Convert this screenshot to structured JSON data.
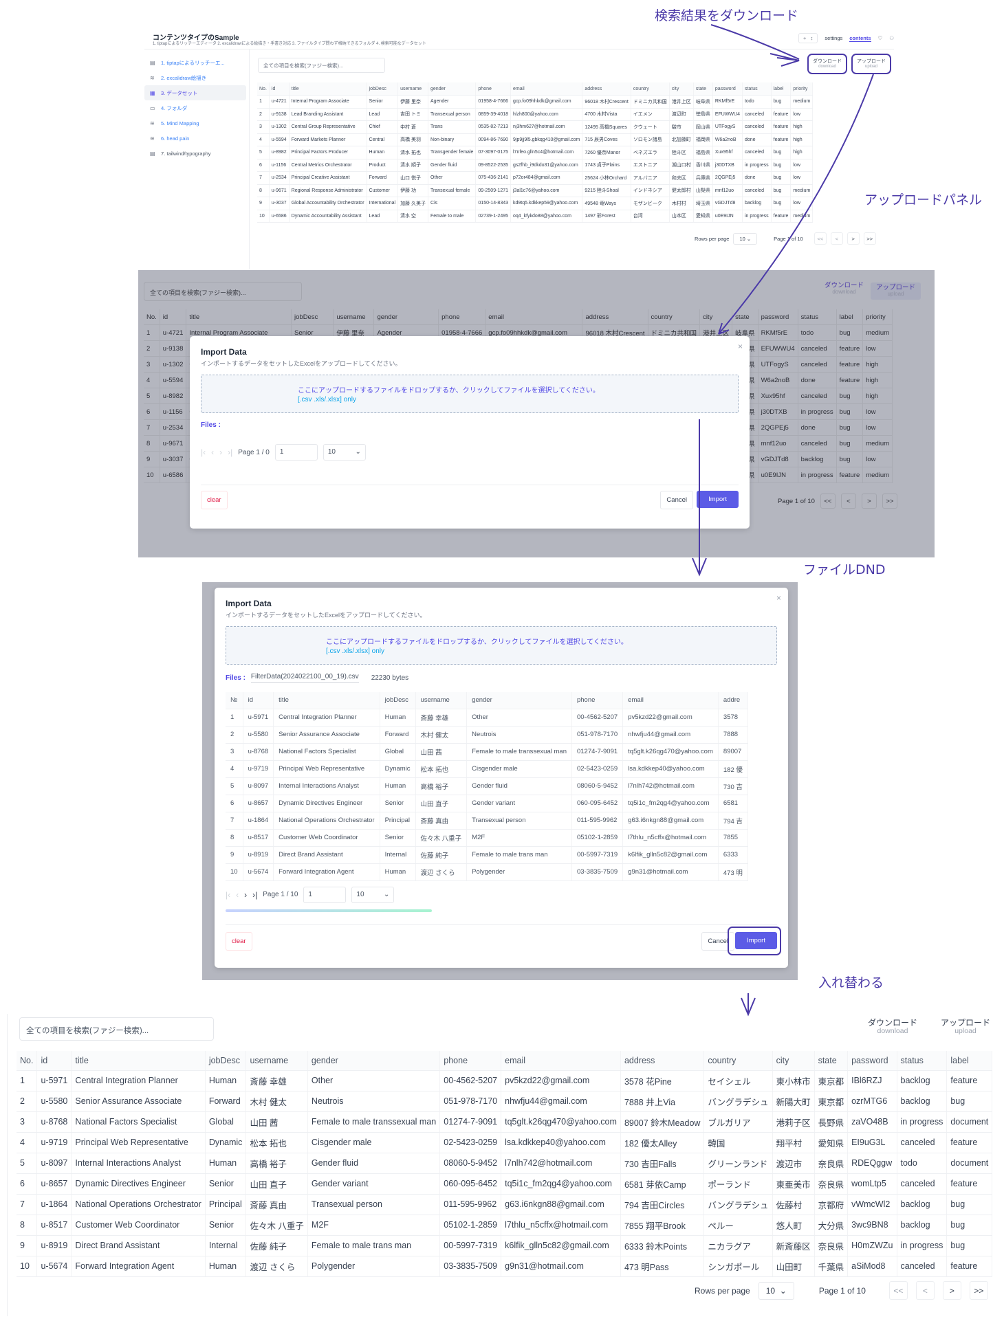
{
  "annotations": {
    "download_result": "検索結果をダウンロード",
    "upload_panel": "アップロードパネル",
    "file_dnd": "ファイルDND",
    "swap": "入れ替わる"
  },
  "colors": {
    "accent": "#4f46e5",
    "annotation": "#4b3aa8",
    "import_button": "#5b5be6",
    "clear_text": "#e11d48",
    "overlay": "#b4b6bf"
  },
  "app": {
    "title": "コンテンツタイプのSample",
    "subtitle": "1. tiptapによるリッチーエディータ 2. excalidrawによる絵描き・手書き対応 3. ファイルタイプ問わず格納できるフォルダ 4. 検索可能なデータセット",
    "topbar": {
      "plus": "+",
      "updown": "↕",
      "tabs": [
        "settings",
        "contents"
      ],
      "active_tab": "contents",
      "heart_icon": "heart-icon",
      "user_icon": "user-icon"
    },
    "sidebar": [
      {
        "label": "1. tiptapによるリッチーエ...",
        "icon": "document-icon"
      },
      {
        "label": "2. excalidraw絵描き",
        "icon": "sketch-icon"
      },
      {
        "label": "3. データセット",
        "icon": "table-icon",
        "active": true
      },
      {
        "label": "4. フォルダ",
        "icon": "folder-icon"
      },
      {
        "label": "5. Mind Mapping",
        "icon": "sketch-icon"
      },
      {
        "label": "6. head pain",
        "icon": "sketch-icon"
      },
      {
        "label": "7. tailwind/typography",
        "icon": "document-icon"
      }
    ]
  },
  "search": {
    "placeholder": "全ての項目を検索(ファジー検索)..."
  },
  "actions": {
    "download": "ダウンロード",
    "download_sub": "download",
    "upload": "アップロード",
    "upload_sub": "upload"
  },
  "table": {
    "columns": [
      "No.",
      "id",
      "title",
      "jobDesc",
      "username",
      "gender",
      "phone",
      "email",
      "address",
      "country",
      "city",
      "state",
      "password",
      "status",
      "label",
      "priority"
    ],
    "rows_before": [
      [
        "1",
        "u-4721",
        "Internal Program Associate",
        "Senior",
        "伊藤 里奈",
        "Agender",
        "01958-4-7666",
        "gcp.fo09hhkdk@gmail.com",
        "96018 木村Crescent",
        "ドミニカ共和国",
        "港井上区",
        "岐阜県",
        "RKMf5rE",
        "todo",
        "bug",
        "medium"
      ],
      [
        "2",
        "u-9138",
        "Lead Branding Assistant",
        "Lead",
        "吉田 トミ",
        "Transexual person",
        "0859-39-4018",
        "hlzh800@yahoo.com",
        "4700 木村Vista",
        "イエメン",
        "渡辺町",
        "徳島県",
        "EFUWWU4",
        "canceled",
        "feature",
        "low"
      ],
      [
        "3",
        "u-1302",
        "Central Group Representative",
        "Chief",
        "中村 蒼",
        "Trans",
        "0535-82-7213",
        "nj3hm627@hotmail.com",
        "12495 高橋Squares",
        "クウェート",
        "駿市",
        "岡山県",
        "UTFogyS",
        "canceled",
        "feature",
        "high"
      ],
      [
        "4",
        "u-5594",
        "Forward Markets Planner",
        "Central",
        "高橋 美羽",
        "Non-binary",
        "0094-86-7690",
        "9jp9jj9l5.gbkqg410@gmail.com",
        "715 辰男Coves",
        "ソロモン諸島",
        "北加藤町",
        "福岡県",
        "W6a2noB",
        "done",
        "feature",
        "high"
      ],
      [
        "5",
        "u-8982",
        "Principal Factors Producer",
        "Human",
        "清水 拓也",
        "Transgender female",
        "07-3097-0175",
        "l7nfeo.glln5c4@hotmail.com",
        "7260 優奈Manor",
        "ベネズエラ",
        "陸斗区",
        "福島県",
        "Xux95hf",
        "canceled",
        "bug",
        "high"
      ],
      [
        "6",
        "u-1156",
        "Central Metrics Orchestrator",
        "Product",
        "清水 順子",
        "Gender fluid",
        "09-8522-2535",
        "gs2fhb_i9dkdo31@yahoo.com",
        "1743 貞子Plains",
        "エストニア",
        "湖山口村",
        "香川県",
        "j30DTXB",
        "in progress",
        "bug",
        "low"
      ],
      [
        "7",
        "u-2534",
        "Principal Creative Assistant",
        "Forward",
        "山口 悦子",
        "Other",
        "075-436-2141",
        "p72or484@gmail.com",
        "25624 小林Orchard",
        "アルバニア",
        "和夫区",
        "兵庫県",
        "2QGPEj5",
        "done",
        "bug",
        "low"
      ],
      [
        "8",
        "u-9671",
        "Regional Response Administrator",
        "Customer",
        "伊藤 功",
        "Transexual female",
        "09-2509-1271",
        "j3al1c76@yahoo.com",
        "9215 陸斗Shoal",
        "インドネシア",
        "健太郎村",
        "山梨県",
        "mnf12uo",
        "canceled",
        "bug",
        "medium"
      ],
      [
        "9",
        "u-3037",
        "Global Accountability Orchestrator",
        "International",
        "加藤 久美子",
        "Cis",
        "0150-14-8343",
        "kd9tq5.kdkkep59@yahoo.com",
        "49548 竜Ways",
        "モザンビーク",
        "木村村",
        "埼玉県",
        "vGDJTd8",
        "backlog",
        "bug",
        "low"
      ],
      [
        "10",
        "u-6586",
        "Dynamic Accountability Assistant",
        "Lead",
        "清水 空",
        "Female to male",
        "02739-1-2495",
        "oq4_kfykdo88@yahoo.com",
        "1497 彩Forest",
        "台湾",
        "山本区",
        "愛知県",
        "u0E9IJN",
        "in progress",
        "feature",
        "medium"
      ]
    ],
    "rows_after": [
      [
        "1",
        "u-5971",
        "Central Integration Planner",
        "Human",
        "斎藤 幸雄",
        "Other",
        "00-4562-5207",
        "pv5kzd22@gmail.com",
        "3578 花Pine",
        "セイシェル",
        "東小林市",
        "東京都",
        "IBl6RZJ",
        "backlog",
        "feature"
      ],
      [
        "2",
        "u-5580",
        "Senior Assurance Associate",
        "Forward",
        "木村 健太",
        "Neutrois",
        "051-978-7170",
        "nhwfju44@gmail.com",
        "7888 井上Via",
        "バングラデシュ",
        "新陽大町",
        "東京都",
        "ozrMTG6",
        "backlog",
        "bug"
      ],
      [
        "3",
        "u-8768",
        "National Factors Specialist",
        "Global",
        "山田 茜",
        "Female to male transsexual man",
        "01274-7-9091",
        "tq5glt.k26qg470@yahoo.com",
        "89007 鈴木Meadow",
        "ブルガリア",
        "港莉子区",
        "長野県",
        "zaVO48B",
        "in progress",
        "document"
      ],
      [
        "4",
        "u-9719",
        "Principal Web Representative",
        "Dynamic",
        "松本 拓也",
        "Cisgender male",
        "02-5423-0259",
        "lsa.kdkkep40@yahoo.com",
        "182 優太Alley",
        "韓国",
        "翔平村",
        "愛知県",
        "EI9uG3L",
        "canceled",
        "feature"
      ],
      [
        "5",
        "u-8097",
        "Internal Interactions Analyst",
        "Human",
        "高橋 裕子",
        "Gender fluid",
        "08060-5-9452",
        "l7nlh742@hotmail.com",
        "730 吉田Falls",
        "グリーンランド",
        "渡辺市",
        "奈良県",
        "RDEQggw",
        "todo",
        "document"
      ],
      [
        "6",
        "u-8657",
        "Dynamic Directives Engineer",
        "Senior",
        "山田 直子",
        "Gender variant",
        "060-095-6452",
        "tq5i1c_fm2qg4@yahoo.com",
        "6581 芽依Camp",
        "ポーランド",
        "東亜美市",
        "奈良県",
        "womLtp5",
        "canceled",
        "feature"
      ],
      [
        "7",
        "u-1864",
        "National Operations Orchestrator",
        "Principal",
        "斎藤 真由",
        "Transexual person",
        "011-595-9962",
        "g63.i6nkgn88@gmail.com",
        "794 吉田Circles",
        "バングラデシュ",
        "佐藤村",
        "京都府",
        "vWmcWl2",
        "backlog",
        "bug"
      ],
      [
        "8",
        "u-8517",
        "Customer Web Coordinator",
        "Senior",
        "佐々木 八重子",
        "M2F",
        "05102-1-2859",
        "l7thlu_n5cffx@hotmail.com",
        "7855 翔平Brook",
        "ペルー",
        "悠人町",
        "大分県",
        "3wc9BN8",
        "backlog",
        "bug"
      ],
      [
        "9",
        "u-8919",
        "Direct Brand Assistant",
        "Internal",
        "佐藤 純子",
        "Female to male trans man",
        "00-5997-7319",
        "k6lfik_glln5c82@gmail.com",
        "6333 鈴木Points",
        "ニカラグア",
        "新斎藤区",
        "奈良県",
        "H0mZWZu",
        "in progress",
        "bug"
      ],
      [
        "10",
        "u-5674",
        "Forward Integration Agent",
        "Human",
        "渡辺 さくら",
        "Polygender",
        "03-3835-7509",
        "g9n31@hotmail.com",
        "473 明Pass",
        "シンガポール",
        "山田町",
        "千葉県",
        "aSiMod8",
        "canceled",
        "feature"
      ]
    ]
  },
  "pager": {
    "rows_per_page_label": "Rows per page",
    "rows_per_page": "10",
    "page_text": "Page 1 of 10",
    "first": "<<",
    "prev": "<",
    "next": ">",
    "last": ">>"
  },
  "modal": {
    "title": "Import Data",
    "description": "インポートするデータをセットしたExcelをアップロードしてください。",
    "dropzone_text": "ここにアップロードするファイルをドロップするか、クリックしてファイルを選択してください。",
    "dropzone_hint": "[.csv .xls/.xlsx] only",
    "files_label": "Files :",
    "file_name": "FilterData(2024022100_00_19).csv",
    "file_size": "22230 bytes",
    "empty_page_text": "Page 1 / 0",
    "page_text": "Page 1 / 10",
    "page_input": "1",
    "page_size": "10",
    "clear": "clear",
    "cancel": "Cancel",
    "import": "Import",
    "close": "×",
    "preview_columns": [
      "№",
      "id",
      "title",
      "jobDesc",
      "username",
      "gender",
      "phone",
      "email",
      "addre"
    ],
    "progress": 0.62
  }
}
